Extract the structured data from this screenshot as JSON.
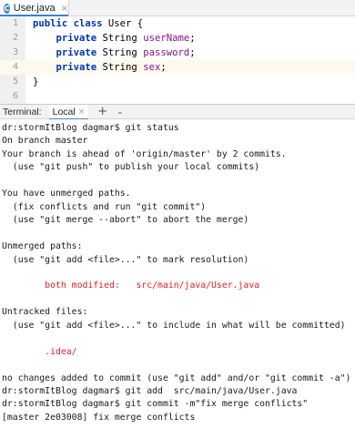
{
  "editor_tab": {
    "label": "User.java",
    "icon": "c-class-icon",
    "icon_letter": "C",
    "close": "×"
  },
  "code": [
    {
      "num": "1",
      "tokens": [
        [
          "kw",
          "public class "
        ],
        [
          "cls",
          "User {"
        ]
      ]
    },
    {
      "num": "2",
      "tokens": [
        [
          "kw",
          "    private "
        ],
        [
          "type",
          "String "
        ],
        [
          "field",
          "userName"
        ],
        [
          "ident",
          ";"
        ]
      ]
    },
    {
      "num": "3",
      "tokens": [
        [
          "kw",
          "    private "
        ],
        [
          "type",
          "String "
        ],
        [
          "field",
          "password"
        ],
        [
          "ident",
          ";"
        ]
      ]
    },
    {
      "num": "4",
      "tokens": [
        [
          "kw",
          "    private "
        ],
        [
          "type",
          "String "
        ],
        [
          "field",
          "sex"
        ],
        [
          "ident",
          ";"
        ]
      ],
      "current": true
    },
    {
      "num": "5",
      "tokens": [
        [
          "ident",
          "}"
        ]
      ]
    },
    {
      "num": "6",
      "tokens": []
    }
  ],
  "terminal_header": {
    "title": "Terminal:",
    "tab_label": "Local",
    "tab_close": "×",
    "add": "+",
    "more": "⌄"
  },
  "terminal_lines": [
    {
      "text": "dr:stormItBlog dagmar$ git status",
      "style": "normal"
    },
    {
      "text": "On branch master",
      "style": "normal"
    },
    {
      "text": "Your branch is ahead of 'origin/master' by 2 commits.",
      "style": "normal"
    },
    {
      "text": "  (use \"git push\" to publish your local commits)",
      "style": "normal"
    },
    {
      "text": "",
      "style": "normal"
    },
    {
      "text": "You have unmerged paths.",
      "style": "normal"
    },
    {
      "text": "  (fix conflicts and run \"git commit\")",
      "style": "normal"
    },
    {
      "text": "  (use \"git merge --abort\" to abort the merge)",
      "style": "normal"
    },
    {
      "text": "",
      "style": "normal"
    },
    {
      "text": "Unmerged paths:",
      "style": "normal"
    },
    {
      "text": "  (use \"git add <file>...\" to mark resolution)",
      "style": "normal"
    },
    {
      "text": "",
      "style": "normal"
    },
    {
      "text": "        both modified:   src/main/java/User.java",
      "style": "red"
    },
    {
      "text": "",
      "style": "normal"
    },
    {
      "text": "Untracked files:",
      "style": "normal"
    },
    {
      "text": "  (use \"git add <file>...\" to include in what will be committed)",
      "style": "normal"
    },
    {
      "text": "",
      "style": "normal"
    },
    {
      "text": "        .idea/",
      "style": "red"
    },
    {
      "text": "",
      "style": "normal"
    },
    {
      "text": "no changes added to commit (use \"git add\" and/or \"git commit -a\")",
      "style": "normal"
    },
    {
      "text": "dr:stormItBlog dagmar$ git add  src/main/java/User.java",
      "style": "normal"
    },
    {
      "text": "dr:stormItBlog dagmar$ git commit -m\"fix merge conflicts\"",
      "style": "normal"
    },
    {
      "text": "[master 2e03008] fix merge conflicts",
      "style": "normal"
    }
  ],
  "colors": {
    "accent": "#4083c9",
    "keyword": "#0033b3",
    "field": "#871094",
    "terminal_red": "#e02020",
    "current_line": "#fcfaed"
  }
}
